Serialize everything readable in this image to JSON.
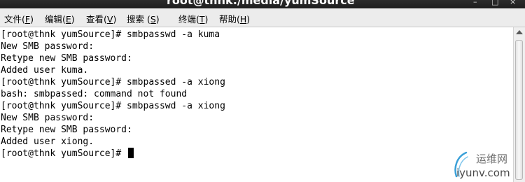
{
  "window": {
    "title": "root@thnk:/media/yumSource",
    "controls": [
      "–",
      "□",
      "×"
    ]
  },
  "menubar": {
    "items": [
      {
        "label": "文件(",
        "mnemonic": "F",
        "suffix": ")"
      },
      {
        "label": "编辑(",
        "mnemonic": "E",
        "suffix": ")"
      },
      {
        "label": "查看(",
        "mnemonic": "V",
        "suffix": ")"
      },
      {
        "label": "搜索 (",
        "mnemonic": "S",
        "suffix": ")"
      },
      {
        "label": "终端(",
        "mnemonic": "T",
        "suffix": ")"
      },
      {
        "label": "帮助(",
        "mnemonic": "H",
        "suffix": ")"
      }
    ]
  },
  "terminal": {
    "lines": [
      "[root@thnk yumSource]# smbpasswd -a kuma",
      "New SMB password:",
      "Retype new SMB password:",
      "Added user kuma.",
      "[root@thnk yumSource]# smbpassed -a xiong",
      "bash: smbpassed: command not found",
      "[root@thnk yumSource]# smbpasswd -a xiong",
      "New SMB password:",
      "Retype new SMB password:",
      "Added user xiong.",
      "[root@thnk yumSource]# "
    ]
  },
  "watermark": {
    "name": "运维网",
    "domain": "iyunv.com"
  },
  "colors": {
    "terminal_bg": "#ffffff",
    "terminal_fg": "#000000",
    "titlebar_bg": "#2c2c2c",
    "menubar_bg": "#ececec",
    "watermark_accent": "#3aa0d8"
  }
}
